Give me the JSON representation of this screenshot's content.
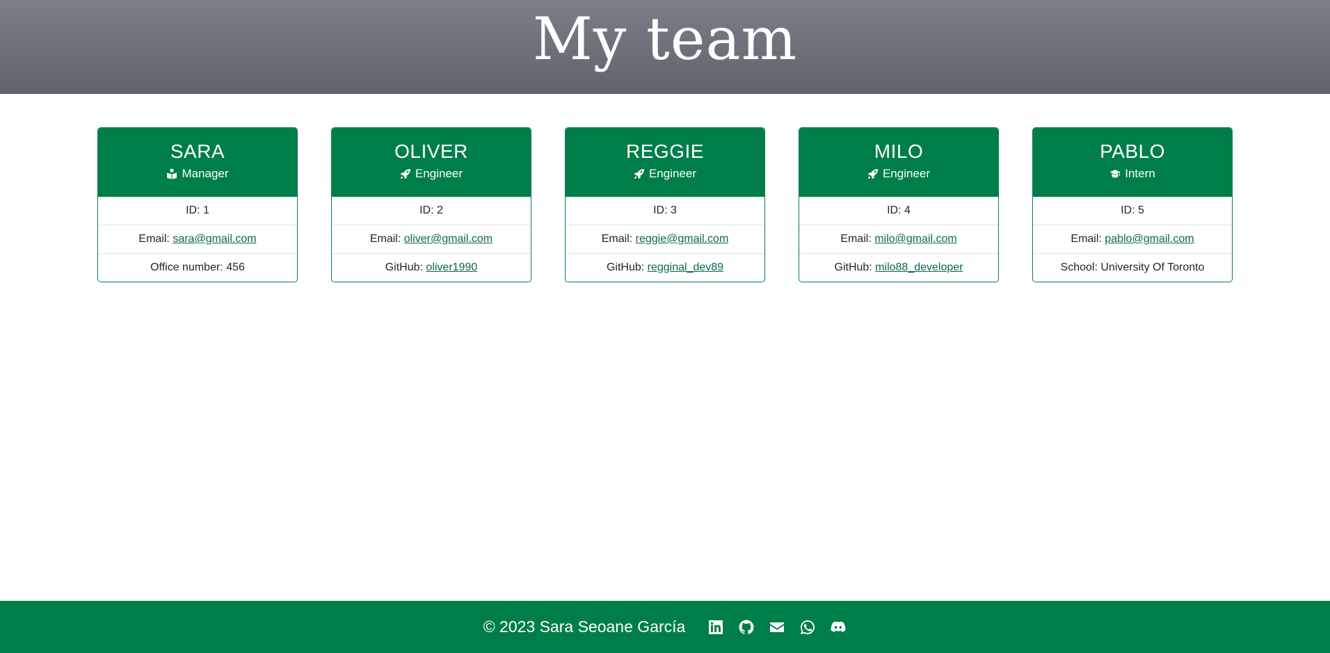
{
  "header": {
    "title": "My team"
  },
  "team": [
    {
      "name": "SARA",
      "role": "Manager",
      "role_icon": "book-reader-icon",
      "id_label": "ID: 1",
      "email_prefix": "Email: ",
      "email": "sara@gmail.com",
      "extra_prefix": "Office number: 456",
      "extra_link": ""
    },
    {
      "name": "OLIVER",
      "role": "Engineer",
      "role_icon": "rocket-icon",
      "id_label": "ID: 2",
      "email_prefix": "Email: ",
      "email": "oliver@gmail.com",
      "extra_prefix": "GitHub: ",
      "extra_link": "oliver1990"
    },
    {
      "name": "REGGIE",
      "role": "Engineer",
      "role_icon": "rocket-icon",
      "id_label": "ID: 3",
      "email_prefix": "Email: ",
      "email": "reggie@gmail.com",
      "extra_prefix": "GitHub: ",
      "extra_link": "regginal_dev89"
    },
    {
      "name": "MILO",
      "role": "Engineer",
      "role_icon": "rocket-icon",
      "id_label": "ID: 4",
      "email_prefix": "Email: ",
      "email": "milo@gmail.com",
      "extra_prefix": "GitHub: ",
      "extra_link": "milo88_developer"
    },
    {
      "name": "PABLO",
      "role": "Intern",
      "role_icon": "graduation-cap-icon",
      "id_label": "ID: 5",
      "email_prefix": "Email: ",
      "email": "pablo@gmail.com",
      "extra_prefix": "School: University Of Toronto",
      "extra_link": ""
    }
  ],
  "footer": {
    "copyright": "© 2023 Sara Seoane García",
    "social_icons": [
      "linkedin-icon",
      "github-icon",
      "envelope-icon",
      "whatsapp-icon",
      "discord-icon"
    ]
  },
  "colors": {
    "accent": "#007e4a",
    "header_top": "#7a7f87",
    "header_bottom": "#60656d",
    "link": "#0b6b3f"
  }
}
